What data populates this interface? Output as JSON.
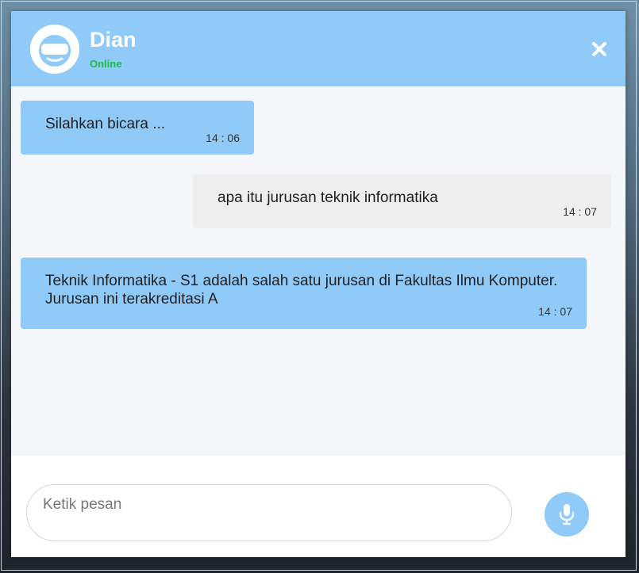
{
  "contact": {
    "name": "Dian",
    "status": "Online"
  },
  "messages": [
    {
      "sender": "bot",
      "text": "Silahkan bicara ...",
      "time": "14 : 06"
    },
    {
      "sender": "user",
      "text": "apa itu jurusan teknik informatika",
      "time": "14 : 07"
    },
    {
      "sender": "bot",
      "text": "Teknik Informatika - S1 adalah salah satu jurusan di Fakultas Ilmu Komputer. Jurusan ini terakreditasi A",
      "time": "14 : 07"
    }
  ],
  "input": {
    "placeholder": "Ketik pesan",
    "value": ""
  },
  "icons": {
    "avatar": "vr-headset-avatar-icon",
    "close": "close-icon",
    "mic": "microphone-icon"
  },
  "colors": {
    "header": "#90caf9",
    "bot_bubble": "#90caf9",
    "user_bubble": "#eeeeee",
    "status_online": "#21b84a",
    "messages_bg": "#f5f6f9"
  }
}
